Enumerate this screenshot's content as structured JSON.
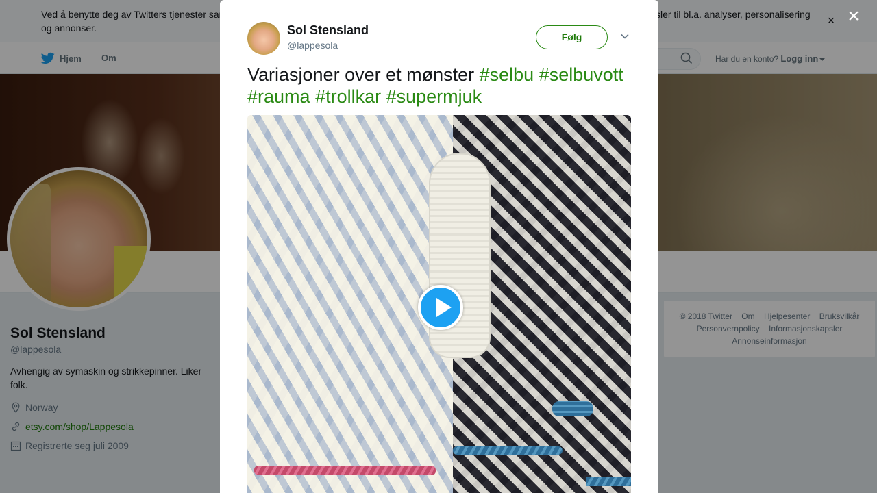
{
  "cookie_banner": {
    "text": "Ved å benytte deg av Twitters tjenester samtykker du i vår bruk av informasjonskapsler og datadeling med tredjeparter, inkludert informasjonskapsler til bl.a. analyser, personalisering og annonser.",
    "close_glyph": "×"
  },
  "nav": {
    "home_label": "Hjem",
    "about_label": "Om",
    "account_prompt": "Har du en konto?",
    "login_label": "Logg inn"
  },
  "profile": {
    "name": "Sol Stensland",
    "handle": "@lappesola",
    "bio": "Avhengig av symaskin og strikkepinner. Liker folk.",
    "location": "Norway",
    "website": "etsy.com/shop/Lappesola",
    "joined": "Registrerte seg juli 2009"
  },
  "footer": {
    "links_row1": [
      "© 2018 Twitter",
      "Om",
      "Hjelpesenter",
      "Bruksvilkår"
    ],
    "links_row2": [
      "Personvernpolicy",
      "Informasjonskapsler"
    ],
    "links_row3": [
      "Annonseinformasjon"
    ]
  },
  "modal": {
    "close_glyph": "×",
    "author_name": "Sol Stensland",
    "author_handle": "@lappesola",
    "follow_label": "Følg",
    "tweet_text_plain": "Variasjoner over et mønster ",
    "hashtags": [
      "#selbu",
      "#selbuvott",
      "#rauma",
      "#trollkar",
      "#supermjuk"
    ]
  },
  "colors": {
    "link_green": "#2a8a14",
    "play_blue": "#1da1f2"
  }
}
